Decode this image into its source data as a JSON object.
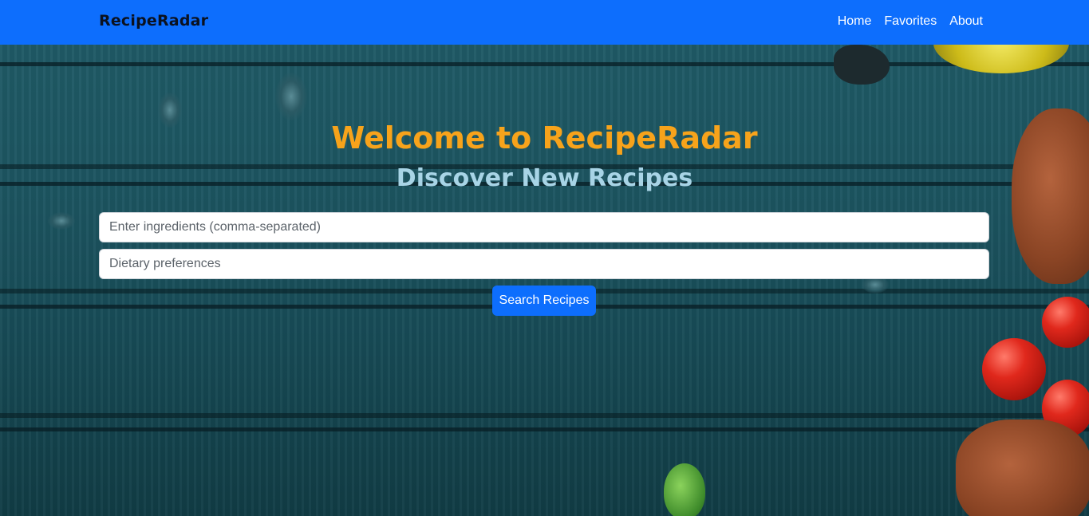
{
  "navbar": {
    "brand": "RecipeRadar",
    "links": [
      {
        "label": "Home"
      },
      {
        "label": "Favorites"
      },
      {
        "label": "About"
      }
    ]
  },
  "hero": {
    "title": "Welcome to RecipeRadar",
    "subtitle": "Discover New Recipes"
  },
  "search": {
    "ingredients_placeholder": "Enter ingredients (comma-separated)",
    "ingredients_value": "",
    "dietary_placeholder": "Dietary preferences",
    "dietary_value": "",
    "button_label": "Search Recipes"
  },
  "colors": {
    "navbar_bg": "#0d6efd",
    "title": "#f7a31b",
    "subtitle": "#a8d4e6",
    "button_bg": "#0d6efd"
  }
}
